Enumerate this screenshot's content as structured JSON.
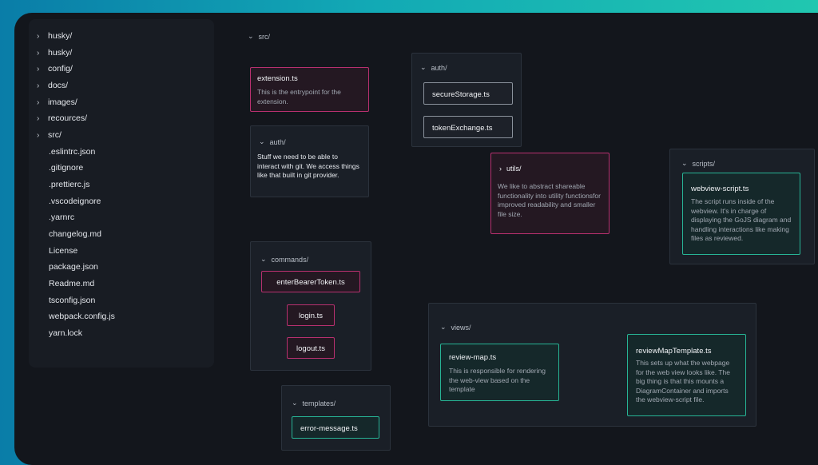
{
  "sidebar": {
    "folders": [
      "husky/",
      "husky/",
      "config/",
      "docs/",
      "images/",
      "recources/",
      "src/"
    ],
    "files": [
      ".eslintrc.json",
      ".gitignore",
      ".prettierc.js",
      ".vscodeignore",
      ".yarnrc",
      "changelog.md",
      "License",
      "package.json",
      "Readme.md",
      "tsconfig.json",
      "webpack.config.js",
      "yarn.lock"
    ]
  },
  "diagram": {
    "src_label": "src/",
    "extension": {
      "title": "extension.ts",
      "desc": "This is the entrypoint for the extension."
    },
    "auth_info": {
      "label": "auth/",
      "desc": "Stuff we need to be able to interact with git. We access things like that built in git provider."
    },
    "auth_group": {
      "label": "auth/",
      "files": [
        "secureStorage.ts",
        "tokenExchange.ts"
      ]
    },
    "utils": {
      "label": "utils/",
      "desc": "We like to abstract shareable functionality into utility functionsfor improved readability and smaller file size."
    },
    "scripts": {
      "label": "scripts/",
      "file_title": "webview-script.ts",
      "file_desc": "The script runs inside of the webview. It's in charge of displaying the GoJS diagram and handling interactions like making files as reviewed."
    },
    "commands": {
      "label": "commands/",
      "files": [
        "enterBearerToken.ts",
        "login.ts",
        "logout.ts"
      ]
    },
    "views": {
      "label": "views/",
      "review_map": {
        "title": "review-map.ts",
        "desc": "This is responsible for rendering the web-view based on the template"
      },
      "template": {
        "title": "reviewMapTemplate.ts",
        "desc": "This sets up what the webpage for the web view looks like. The big thing is that this mounts a DiagramContainer and imports the webview-script file."
      }
    },
    "templates": {
      "label": "templates/",
      "file": "error-message.ts"
    }
  },
  "colors": {
    "pink": "#b8306f",
    "teal": "#27b495",
    "background": "#13161c"
  }
}
